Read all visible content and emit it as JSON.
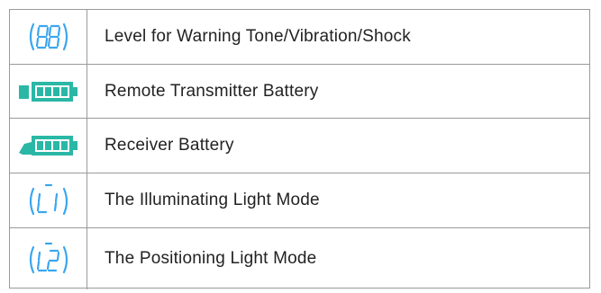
{
  "colors": {
    "blue_segment": "#3aa6ee",
    "teal_battery": "#2ab7a6",
    "border": "#9a9a9a",
    "text": "#222222"
  },
  "rows": [
    {
      "icon": "seven-segment-88-icon",
      "label": "Level for Warning Tone/Vibration/Shock"
    },
    {
      "icon": "transmitter-battery-icon",
      "label": "Remote Transmitter Battery"
    },
    {
      "icon": "receiver-battery-icon",
      "label": "Receiver Battery"
    },
    {
      "icon": "seven-segment-l1-icon",
      "label": "The Illuminating Light Mode"
    },
    {
      "icon": "seven-segment-l2-icon",
      "label": "The Positioning Light Mode"
    }
  ]
}
